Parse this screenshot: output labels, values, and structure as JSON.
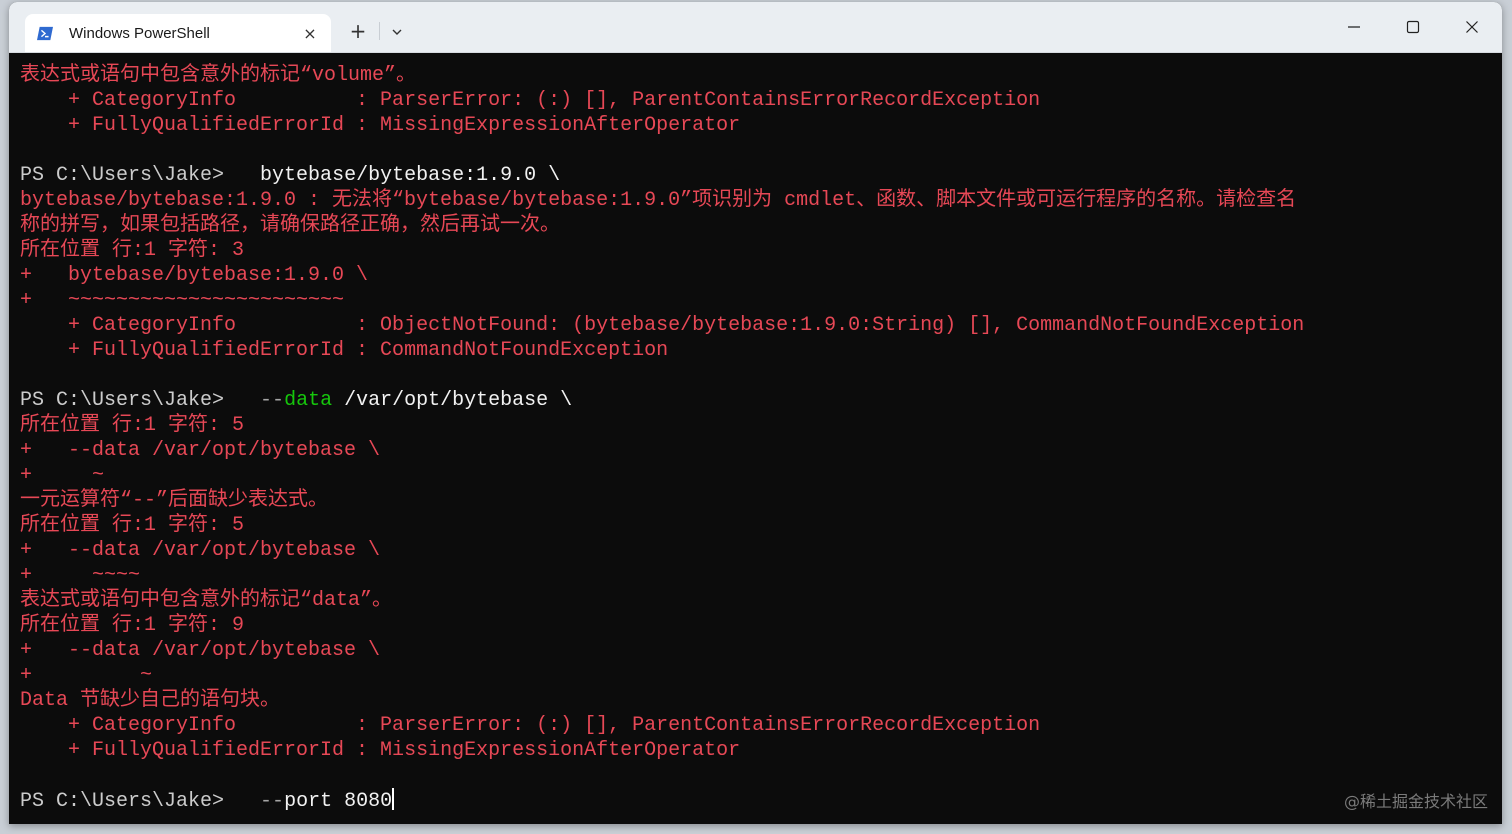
{
  "window": {
    "tab_title": "Windows PowerShell",
    "tab_icon": "powershell-icon",
    "tab_close": "×",
    "new_tab": "+",
    "colors": {
      "error": "#e74856",
      "prompt": "#cccccc",
      "param": "#16c60c",
      "background": "#0c0c0c"
    }
  },
  "terminal": {
    "lines": [
      {
        "segments": [
          {
            "t": "表达式或语句中包含意外的标记“volume”。",
            "c": "err"
          }
        ]
      },
      {
        "segments": [
          {
            "t": "    + CategoryInfo          : ParserError: (:) [], ParentContainsErrorRecordException",
            "c": "err"
          }
        ]
      },
      {
        "segments": [
          {
            "t": "    + FullyQualifiedErrorId : MissingExpressionAfterOperator",
            "c": "err"
          }
        ]
      },
      {
        "segments": [
          {
            "t": "",
            "c": "prompt"
          }
        ]
      },
      {
        "segments": [
          {
            "t": "PS C:\\Users\\Jake> ",
            "c": "prompt"
          },
          {
            "t": "  bytebase/bytebase:1.9.0 \\",
            "c": "cmd"
          }
        ]
      },
      {
        "segments": [
          {
            "t": "bytebase/bytebase:1.9.0 : 无法将“bytebase/bytebase:1.9.0”项识别为 cmdlet、函数、脚本文件或可运行程序的名称。请检查名",
            "c": "err"
          }
        ]
      },
      {
        "segments": [
          {
            "t": "称的拼写，如果包括路径，请确保路径正确，然后再试一次。",
            "c": "err"
          }
        ]
      },
      {
        "segments": [
          {
            "t": "所在位置 行:1 字符: 3",
            "c": "err"
          }
        ]
      },
      {
        "segments": [
          {
            "t": "+   bytebase/bytebase:1.9.0 \\",
            "c": "err"
          }
        ]
      },
      {
        "segments": [
          {
            "t": "+   ~~~~~~~~~~~~~~~~~~~~~~~",
            "c": "err"
          }
        ]
      },
      {
        "segments": [
          {
            "t": "    + CategoryInfo          : ObjectNotFound: (bytebase/bytebase:1.9.0:String) [], CommandNotFoundException",
            "c": "err"
          }
        ]
      },
      {
        "segments": [
          {
            "t": "    + FullyQualifiedErrorId : CommandNotFoundException",
            "c": "err"
          }
        ]
      },
      {
        "segments": [
          {
            "t": "",
            "c": "prompt"
          }
        ]
      },
      {
        "segments": [
          {
            "t": "PS C:\\Users\\Jake> ",
            "c": "prompt"
          },
          {
            "t": "  --",
            "c": "cmd-gray"
          },
          {
            "t": "data",
            "c": "param"
          },
          {
            "t": " /var/opt/bytebase \\",
            "c": "cmd"
          }
        ]
      },
      {
        "segments": [
          {
            "t": "所在位置 行:1 字符: 5",
            "c": "err"
          }
        ]
      },
      {
        "segments": [
          {
            "t": "+   --data /var/opt/bytebase \\",
            "c": "err"
          }
        ]
      },
      {
        "segments": [
          {
            "t": "+     ~",
            "c": "err"
          }
        ]
      },
      {
        "segments": [
          {
            "t": "一元运算符“--”后面缺少表达式。",
            "c": "err"
          }
        ]
      },
      {
        "segments": [
          {
            "t": "所在位置 行:1 字符: 5",
            "c": "err"
          }
        ]
      },
      {
        "segments": [
          {
            "t": "+   --data /var/opt/bytebase \\",
            "c": "err"
          }
        ]
      },
      {
        "segments": [
          {
            "t": "+     ~~~~",
            "c": "err"
          }
        ]
      },
      {
        "segments": [
          {
            "t": "表达式或语句中包含意外的标记“data”。",
            "c": "err"
          }
        ]
      },
      {
        "segments": [
          {
            "t": "所在位置 行:1 字符: 9",
            "c": "err"
          }
        ]
      },
      {
        "segments": [
          {
            "t": "+   --data /var/opt/bytebase \\",
            "c": "err"
          }
        ]
      },
      {
        "segments": [
          {
            "t": "+         ~",
            "c": "err"
          }
        ]
      },
      {
        "segments": [
          {
            "t": "Data 节缺少自己的语句块。",
            "c": "err"
          }
        ]
      },
      {
        "segments": [
          {
            "t": "    + CategoryInfo          : ParserError: (:) [], ParentContainsErrorRecordException",
            "c": "err"
          }
        ]
      },
      {
        "segments": [
          {
            "t": "    + FullyQualifiedErrorId : MissingExpressionAfterOperator",
            "c": "err"
          }
        ]
      },
      {
        "segments": [
          {
            "t": "",
            "c": "prompt"
          }
        ]
      },
      {
        "segments": [
          {
            "t": "PS C:\\Users\\Jake> ",
            "c": "prompt"
          },
          {
            "t": "  --",
            "c": "cmd-gray"
          },
          {
            "t": "port 8080",
            "c": "cmd"
          }
        ],
        "cursor": true
      }
    ]
  },
  "watermark": "@稀土掘金技术社区"
}
